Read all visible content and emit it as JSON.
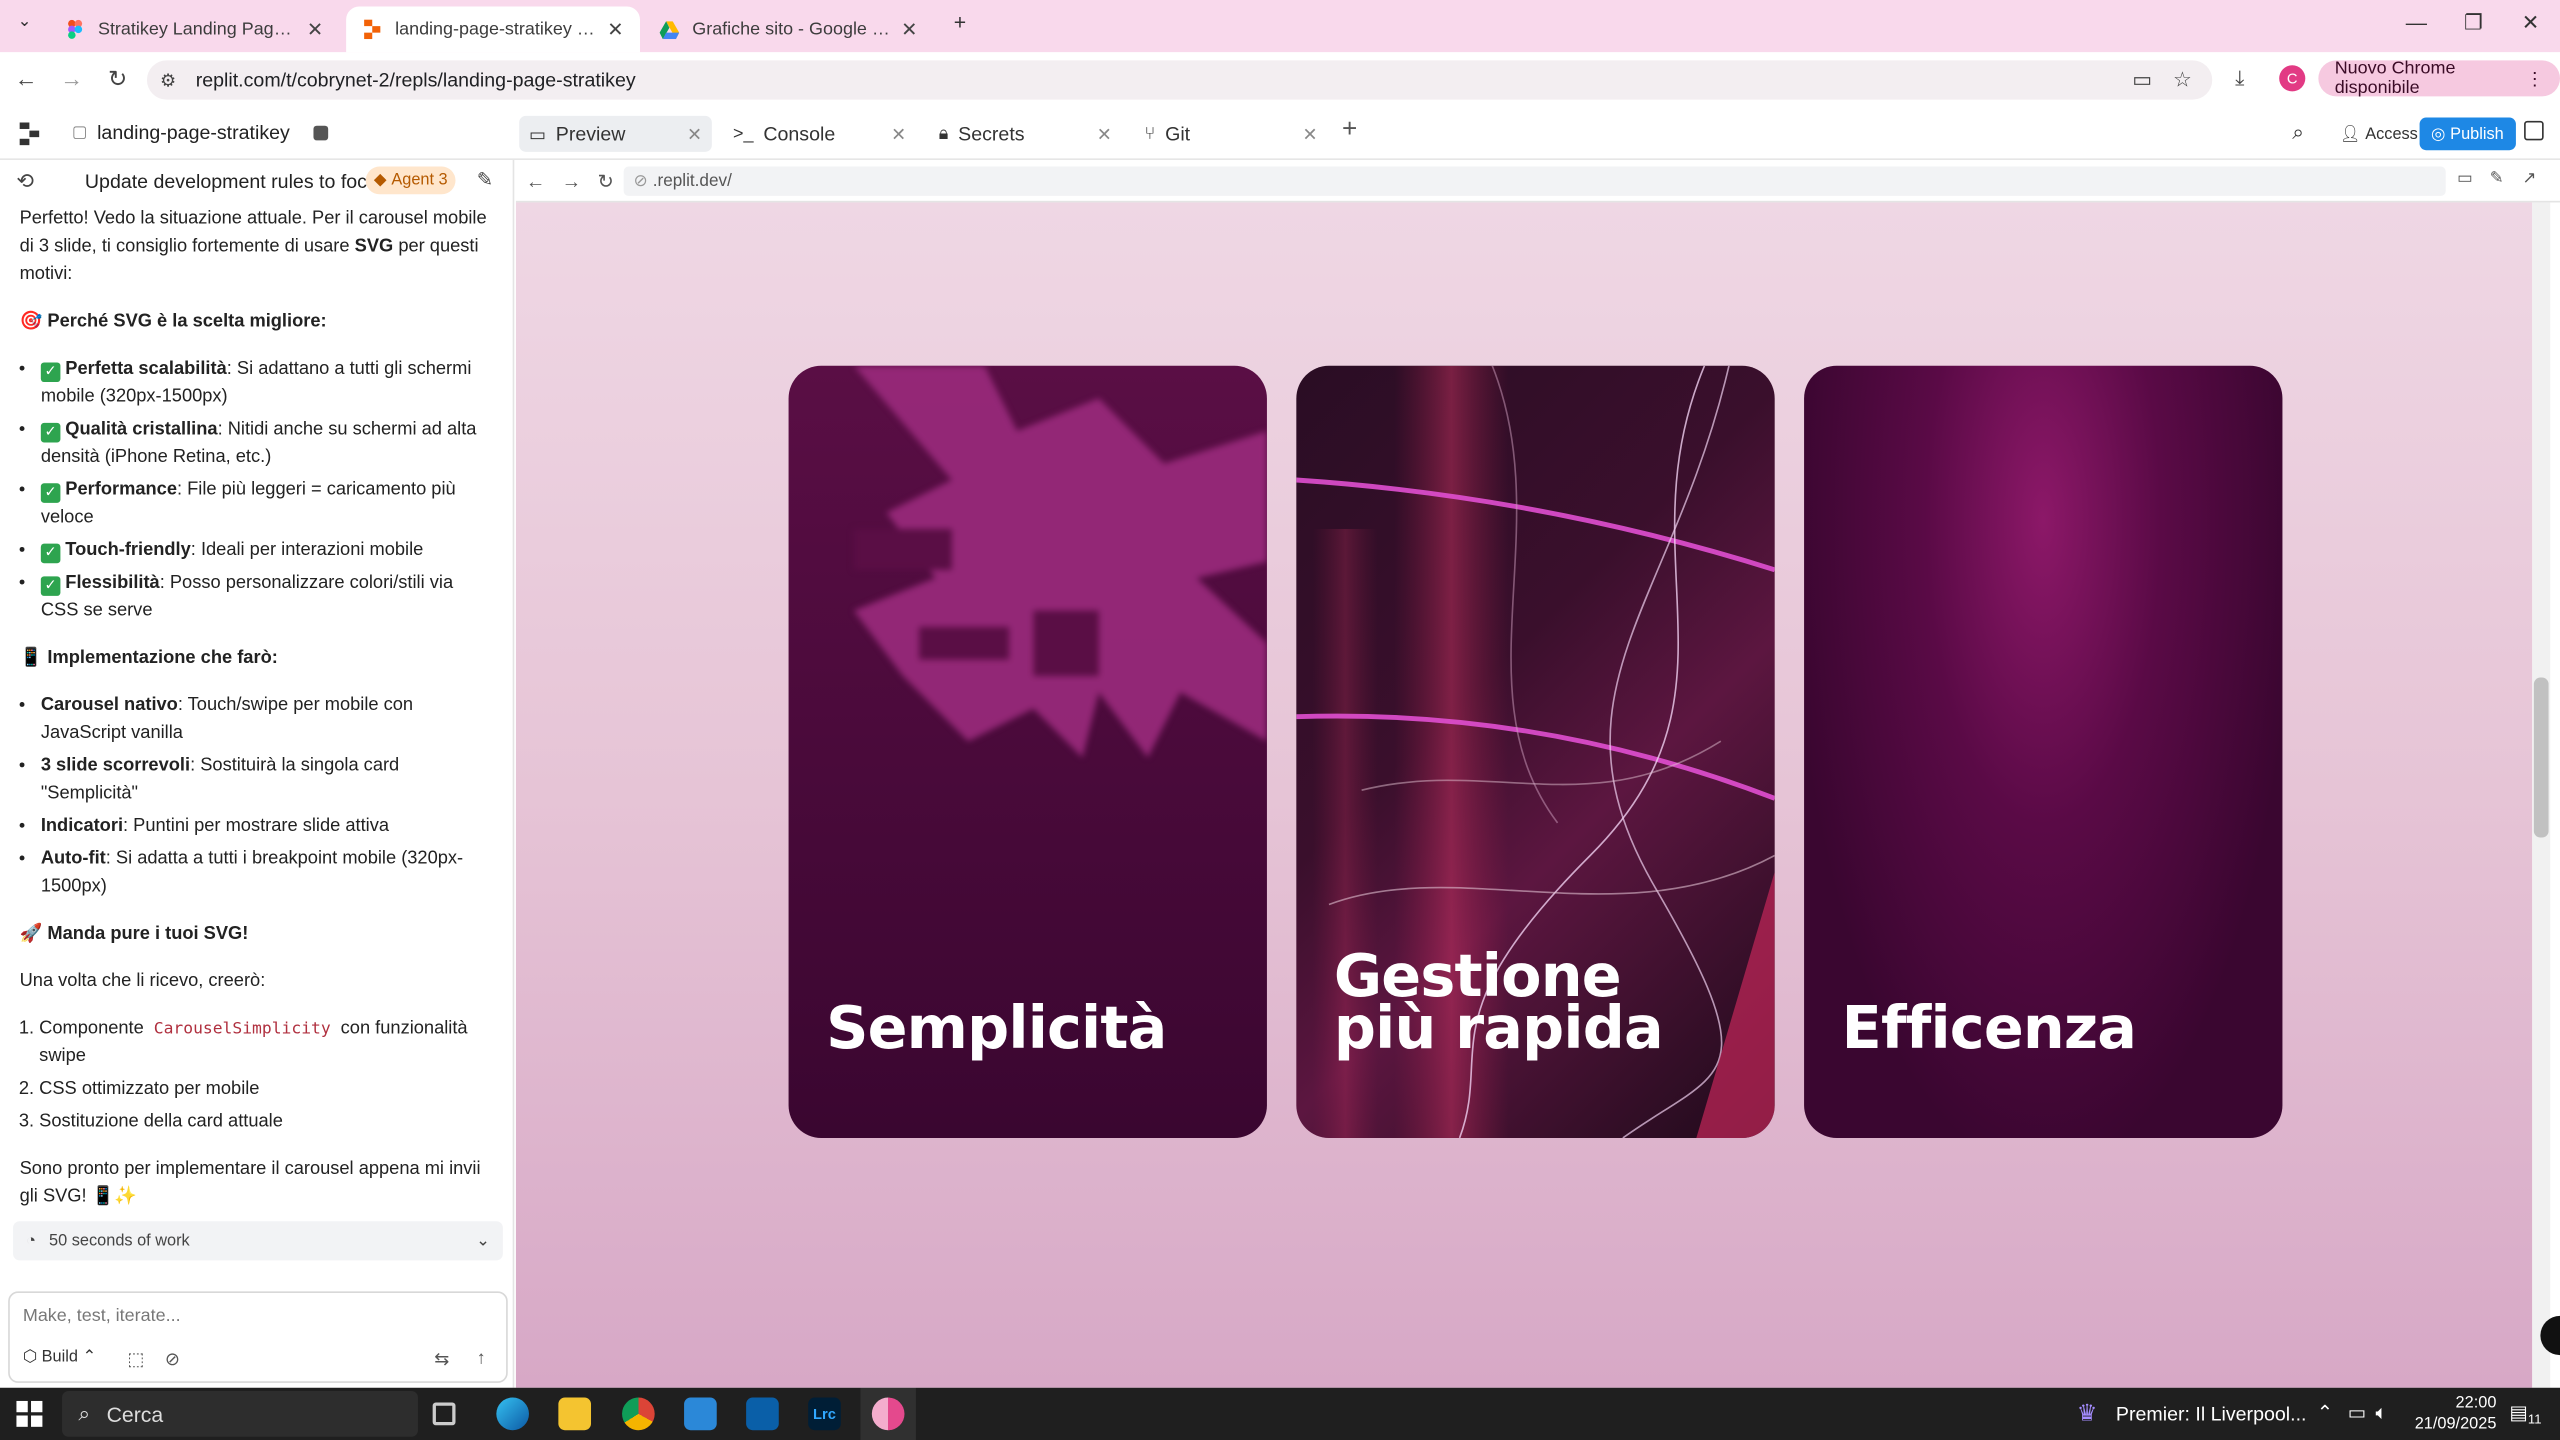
{
  "browser": {
    "tabs": [
      {
        "label": "Stratikey Landing Page – Figma",
        "active": false
      },
      {
        "label": "landing-page-stratikey - Replit",
        "active": true
      },
      {
        "label": "Grafiche sito - Google Drive",
        "active": false
      }
    ],
    "url": "replit.com/t/cobrynet-2/repls/landing-page-stratikey",
    "update_button": "Nuovo Chrome disponibile",
    "profile_initial": "C"
  },
  "replit": {
    "project_name": "landing-page-stratikey",
    "tabs": [
      {
        "label": "Preview",
        "icon": "preview-icon"
      },
      {
        "label": "Console",
        "icon": "terminal-icon"
      },
      {
        "label": "Secrets",
        "icon": "lock-icon"
      },
      {
        "label": "Git",
        "icon": "git-icon"
      }
    ],
    "access_label": "Access",
    "publish_label": "Publish"
  },
  "agent_panel": {
    "title": "Update development rules to foc...",
    "agent_badge": "Agent 3",
    "intro_prefix": "Perfetto! Vedo la situazione attuale. Per il carousel mobile di 3 slide, ti consiglio fortemente di usare ",
    "intro_bold": "SVG",
    "intro_suffix": " per questi motivi:",
    "why_heading": "🎯 Perché SVG è la scelta migliore:",
    "why_items": [
      {
        "bold": "Perfetta scalabilità",
        "text": ": Si adattano a tutti gli schermi mobile (320px-1500px)"
      },
      {
        "bold": "Qualità cristallina",
        "text": ": Nitidi anche su schermi ad alta densità (iPhone Retina, etc.)"
      },
      {
        "bold": "Performance",
        "text": ": File più leggeri = caricamento più veloce"
      },
      {
        "bold": "Touch-friendly",
        "text": ": Ideali per interazioni mobile"
      },
      {
        "bold": "Flessibilità",
        "text": ": Posso personalizzare colori/stili via CSS se serve"
      }
    ],
    "impl_heading": "📱 Implementazione che farò:",
    "impl_items": [
      {
        "bold": "Carousel nativo",
        "text": ": Touch/swipe per mobile con JavaScript vanilla"
      },
      {
        "bold": "3 slide scorrevoli",
        "text": ": Sostituirà la singola card \"Semplicità\""
      },
      {
        "bold": "Indicatori",
        "text": ": Puntini per mostrare slide attiva"
      },
      {
        "bold": "Auto-fit",
        "text": ": Si adatta a tutti i breakpoint mobile (320px-1500px)"
      }
    ],
    "send_heading": "🚀 Manda pure i tuoi SVG!",
    "once_text": "Una volta che li ricevo, creerò:",
    "create_items": [
      {
        "prefix": "Componente ",
        "code": "CarouselSimplicity",
        "suffix": " con funzionalità swipe"
      },
      {
        "prefix": "CSS ottimizzato per mobile",
        "code": "",
        "suffix": ""
      },
      {
        "prefix": "Sostituzione della card attuale",
        "code": "",
        "suffix": ""
      }
    ],
    "closing": "Sono pronto per implementare il carousel appena mi invii gli SVG! 📱✨",
    "work_summary": "50 seconds of work",
    "input_placeholder": "Make, test, iterate...",
    "build_label": "Build"
  },
  "preview": {
    "url": ".replit.dev/",
    "cards": [
      {
        "line1": "Semplicità",
        "line2": ""
      },
      {
        "line1": "Gestione",
        "line2": "più rapida"
      },
      {
        "line1": "Efficenza",
        "line2": ""
      }
    ]
  },
  "taskbar": {
    "search_label": "Cerca",
    "news_label": "Premier: Il Liverpool...",
    "time": "22:00",
    "date": "21/09/2025",
    "notifications": "11"
  }
}
